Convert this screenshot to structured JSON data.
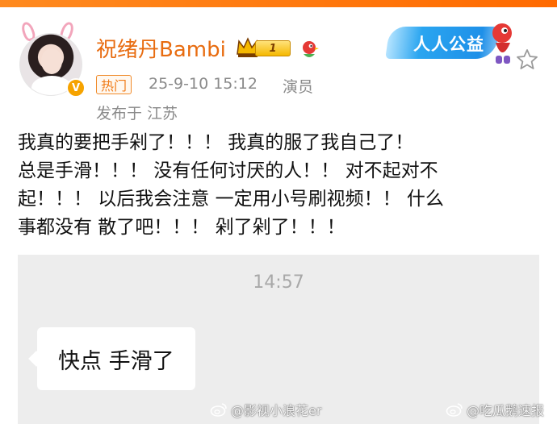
{
  "user": {
    "name": "祝绪丹Bambi",
    "vip_level": "1"
  },
  "meta": {
    "hot_tag": "热门",
    "time": "25-9-10 15:12",
    "role": "演员",
    "location": "发布于 江苏"
  },
  "badge": {
    "charity": "人人公益"
  },
  "post": {
    "lines": [
      "我真的要把手剁了！！！ 我真的服了我自己了！",
      "总是手滑！！！ 没有任何讨厌的人！！ 对不起对不",
      "起！！！ 以后我会注意 一定用小号刷视频！！ 什么",
      "事都没有 散了吧！！！ 剁了剁了！！！"
    ]
  },
  "chat_screenshot": {
    "time": "14:57",
    "message": "快点 手滑了"
  },
  "watermarks": {
    "left": "@影视小浪花er",
    "right": "@吃瓜鹅速报"
  },
  "colors": {
    "username": "#e86c10",
    "accent": "#ff7a00",
    "meta": "#8a8a8a",
    "charity_blue": "#1e90e8"
  }
}
